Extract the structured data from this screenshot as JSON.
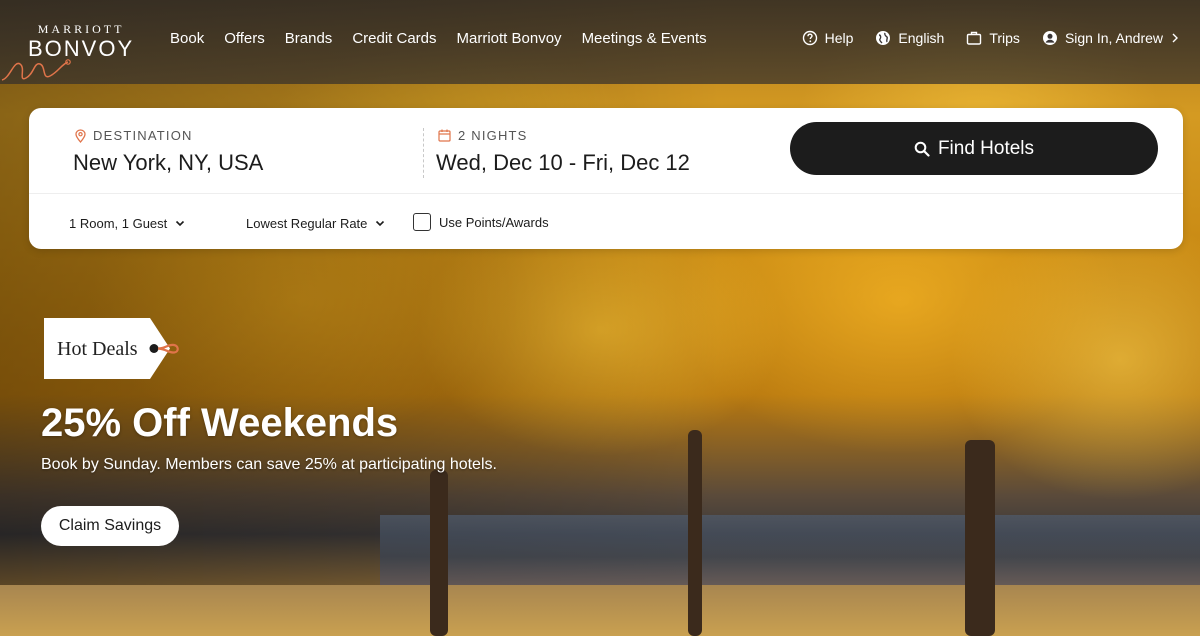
{
  "brand": {
    "top_line": "MARRIOTT",
    "bottom_line": "BONVOY"
  },
  "nav": {
    "items": [
      {
        "label": "Book"
      },
      {
        "label": "Offers"
      },
      {
        "label": "Brands"
      },
      {
        "label": "Credit Cards"
      },
      {
        "label": "Marriott Bonvoy"
      },
      {
        "label": "Meetings & Events"
      }
    ]
  },
  "utility": {
    "help": "Help",
    "language": "English",
    "trips": "Trips",
    "account": "Sign In, Andrew"
  },
  "search": {
    "destination_label": "DESTINATION",
    "destination_value": "New York, NY, USA",
    "dates_label": "2 NIGHTS",
    "dates_value": "Wed, Dec 10 - Fri, Dec 12",
    "find_button": "Find Hotels",
    "rooms_guests": "1 Room, 1 Guest",
    "rate": "Lowest Regular Rate",
    "use_points_label": "Use Points/Awards",
    "use_points_checked": false
  },
  "promo": {
    "tag": "Hot Deals",
    "title": "25% Off Weekends",
    "subtitle": "Book by Sunday. Members can save 25% at participating hotels.",
    "cta": "Claim Savings"
  },
  "colors": {
    "accent": "#e0744a",
    "button_dark": "#1c1c1c"
  }
}
